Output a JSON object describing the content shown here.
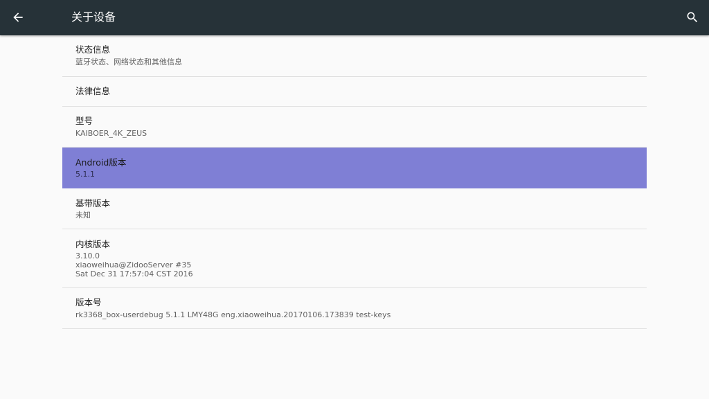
{
  "toolbar": {
    "title": "关于设备",
    "back_icon": "arrow-back-icon",
    "search_icon": "search-icon",
    "background": "#263238"
  },
  "accent": {
    "selected_background": "#7f7fd5"
  },
  "settings": {
    "items": [
      {
        "title": "状态信息",
        "summary": "蓝牙状态、网络状态和其他信息"
      },
      {
        "title": "法律信息",
        "summary": ""
      },
      {
        "title": "型号",
        "summary": "KAIBOER_4K_ZEUS"
      },
      {
        "title": "Android版本",
        "summary": "5.1.1",
        "selected": true
      },
      {
        "title": "基带版本",
        "summary": "未知"
      },
      {
        "title": "内核版本",
        "summary": "3.10.0\nxiaoweihua@ZidooServer #35\nSat Dec 31 17:57:04 CST 2016"
      },
      {
        "title": "版本号",
        "summary": "rk3368_box-userdebug 5.1.1 LMY48G eng.xiaoweihua.20170106.173839 test-keys"
      }
    ]
  }
}
